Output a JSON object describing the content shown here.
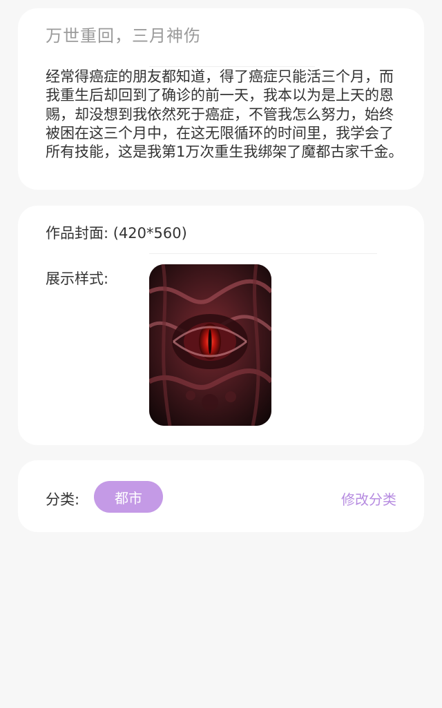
{
  "work": {
    "title": "万世重回，三月神伤",
    "synopsis": "经常得癌症的朋友都知道，得了癌症只能活三个月，而我重生后却回到了确诊的前一天，我本以为是上天的恩赐，却没想到我依然死于癌症，不管我怎么努力，始终被困在这三个月中，在这无限循环的时间里，我学会了所有技能，这是我第1万次重生我绑架了魔都古家千金。"
  },
  "cover": {
    "label": "作品封面: (420*560)",
    "style_label": "展示样式:",
    "image_icon": "dark-red-eye-artwork"
  },
  "category": {
    "label": "分类:",
    "selected": "都市",
    "edit_label": "修改分类",
    "chip_color": "#c49ae6",
    "accent_color": "#b68be0"
  }
}
